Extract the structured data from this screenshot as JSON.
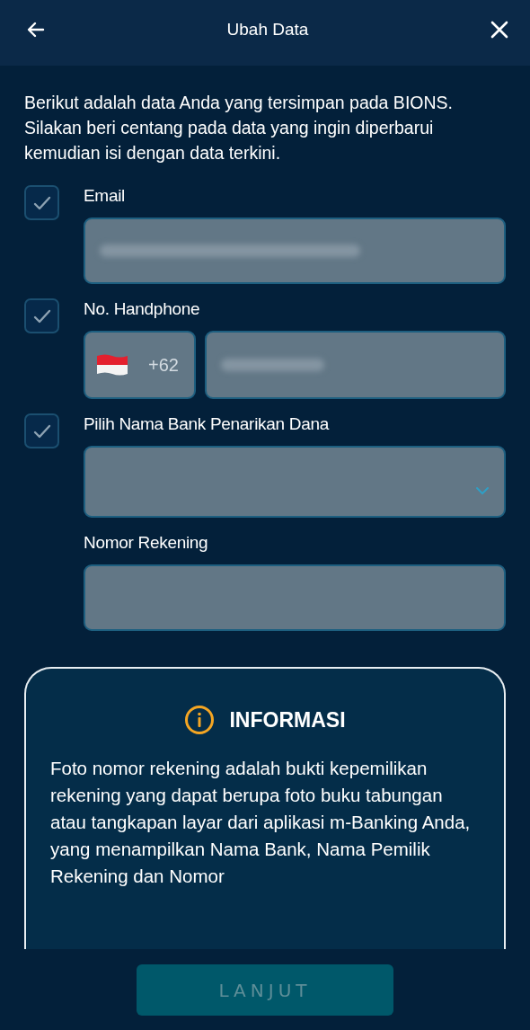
{
  "header": {
    "title": "Ubah Data"
  },
  "intro": "Berikut adalah data Anda yang tersimpan pada BIONS. Silakan beri centang pada data yang ingin diperbarui kemudian isi dengan data terkini.",
  "fields": [
    {
      "kind": "email",
      "label": "Email",
      "checked": true,
      "redacted": true
    },
    {
      "kind": "phone",
      "label": "No. Handphone",
      "checked": true,
      "country_code": "+62",
      "redacted": true
    },
    {
      "kind": "select",
      "label": "Pilih Nama Bank Penarikan Dana",
      "checked": true
    },
    {
      "kind": "text",
      "label": "Nomor Rekening"
    }
  ],
  "info": {
    "title": "INFORMASI",
    "text": "Foto nomor rekening adalah bukti kepemilikan rekening yang dapat berupa foto buku tabungan atau tangkapan layar dari aplikasi m-Banking Anda, yang menampilkan Nama Bank, Nama Pemilik Rekening dan Nomor"
  },
  "button": {
    "label": "LANJUT",
    "disabled": true
  }
}
